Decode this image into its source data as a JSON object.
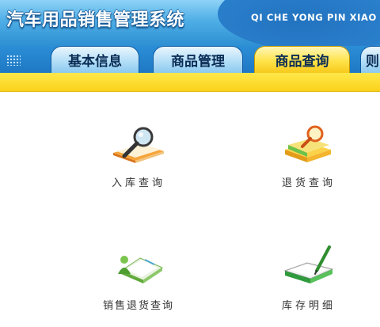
{
  "header": {
    "title": "汽车用品销售管理系统",
    "subtitle": "QI CHE YONG PIN XIAO"
  },
  "tabs": [
    {
      "label": "基本信息"
    },
    {
      "label": "商品管理"
    },
    {
      "label": "商品查询",
      "active": true
    },
    {
      "label": "则"
    }
  ],
  "tiles": [
    {
      "label": "入库查询",
      "icon": "search-book-icon"
    },
    {
      "label": "退货查询",
      "icon": "book-magnifier-icon"
    },
    {
      "label": "销售退货查询",
      "icon": "book-person-icon"
    },
    {
      "label": "库存明细",
      "icon": "book-pen-icon"
    }
  ],
  "colors": {
    "header_blue": "#4eaee6",
    "tab_active": "#ffe34a",
    "strip_yellow": "#fad21b"
  }
}
